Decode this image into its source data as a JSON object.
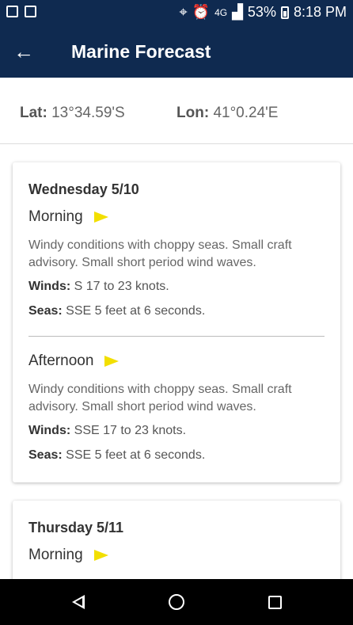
{
  "status_bar": {
    "battery": "53%",
    "time": "8:18 PM",
    "network": "4G",
    "icons": [
      "image-icon",
      "app-icon",
      "location-icon",
      "alarm-icon",
      "signal-icon",
      "battery-icon"
    ]
  },
  "header": {
    "title": "Marine Forecast",
    "back_icon": "arrow-back-icon"
  },
  "coords": {
    "lat_label": "Lat:",
    "lat_value": "13°34.59'S",
    "lon_label": "Lon:",
    "lon_value": "41°0.24'E"
  },
  "days": [
    {
      "title": "Wednesday 5/10",
      "periods": [
        {
          "name": "Morning",
          "description": "Windy conditions with choppy seas. Small craft advisory. Small short period wind waves.",
          "winds_label": "Winds:",
          "winds": "S 17 to 23 knots.",
          "seas_label": "Seas:",
          "seas": "SSE 5 feet at 6 seconds."
        },
        {
          "name": "Afternoon",
          "description": "Windy conditions with choppy seas. Small craft advisory. Small short period wind waves.",
          "winds_label": "Winds:",
          "winds": "SSE 17 to 23 knots.",
          "seas_label": "Seas:",
          "seas": "SSE 5 feet at 6 seconds."
        }
      ]
    },
    {
      "title": "Thursday 5/11",
      "periods": [
        {
          "name": "Morning"
        }
      ]
    }
  ],
  "colors": {
    "primary": "#0f2a50",
    "flag": "#f2df00"
  }
}
